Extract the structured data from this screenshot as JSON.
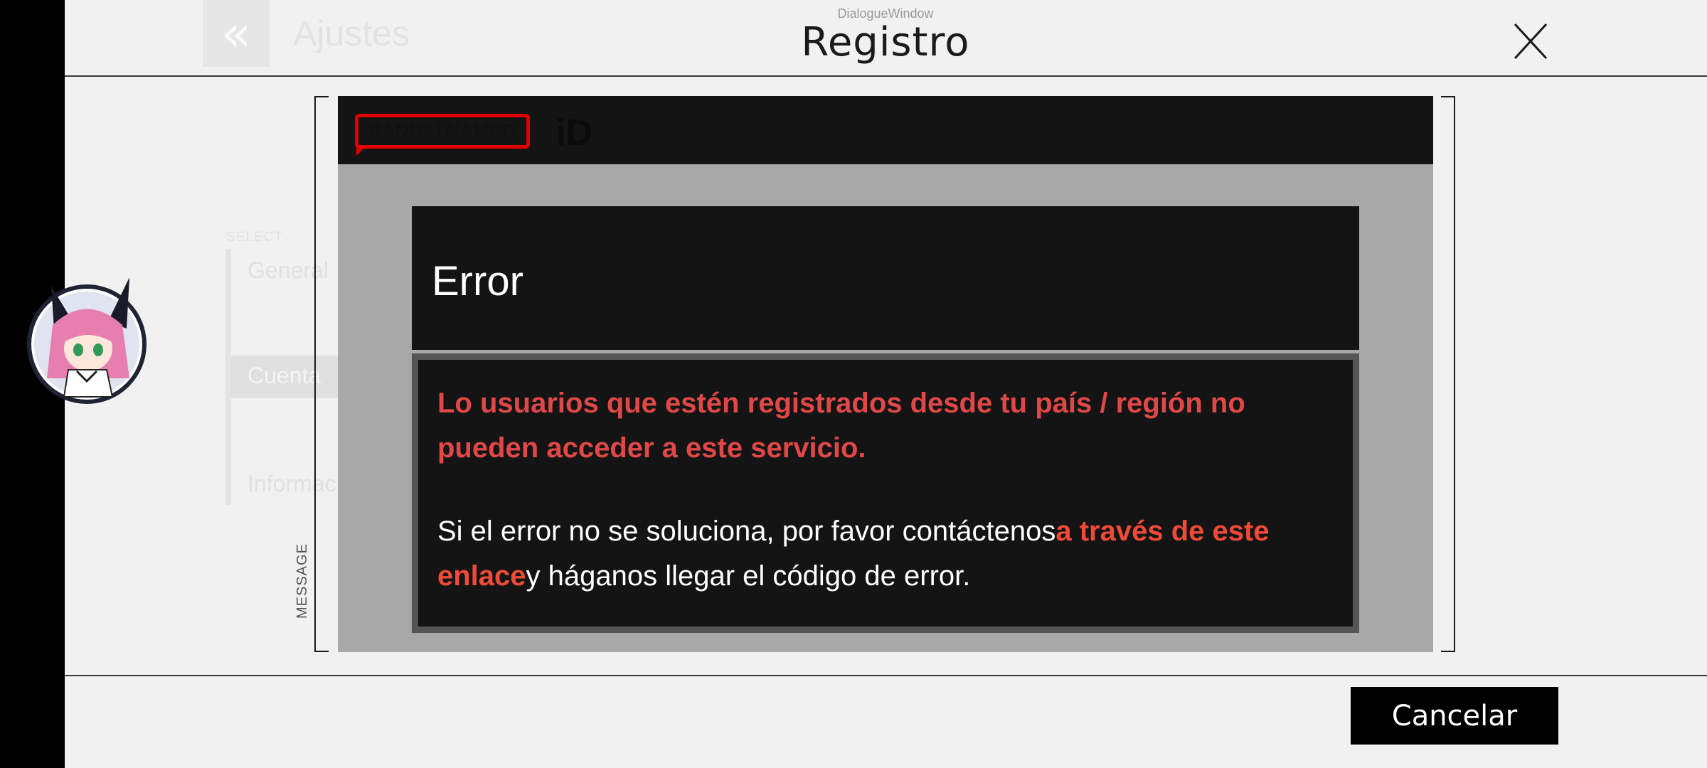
{
  "background": {
    "back_icon": "«",
    "title": "Ajustes",
    "select_label": "SELECT",
    "menu_items": [
      "General",
      "Cuenta",
      "Informac"
    ]
  },
  "dialog": {
    "caption": "DialogueWindow",
    "title": "Registro",
    "close_icon": "close-icon",
    "message_label": "MESSAGE",
    "cancel_label": "Cancelar"
  },
  "webview": {
    "brand_logo_text": "BANDAI NAMCO",
    "brand_id": "iD",
    "brand_color": "#e00000",
    "error": {
      "title": "Error",
      "message": "Lo usuarios que estén registrados desde tu país / región no pueden acceder a este servicio.",
      "help_prefix": "Si el error no se soluciona, por favor contáctenos",
      "help_link": "a través de este enlace",
      "help_suffix": "y háganos llegar el código de error.",
      "message_color": "#e04848",
      "link_color": "#ef4a37"
    }
  },
  "avatar": {
    "description": "character-avatar"
  }
}
